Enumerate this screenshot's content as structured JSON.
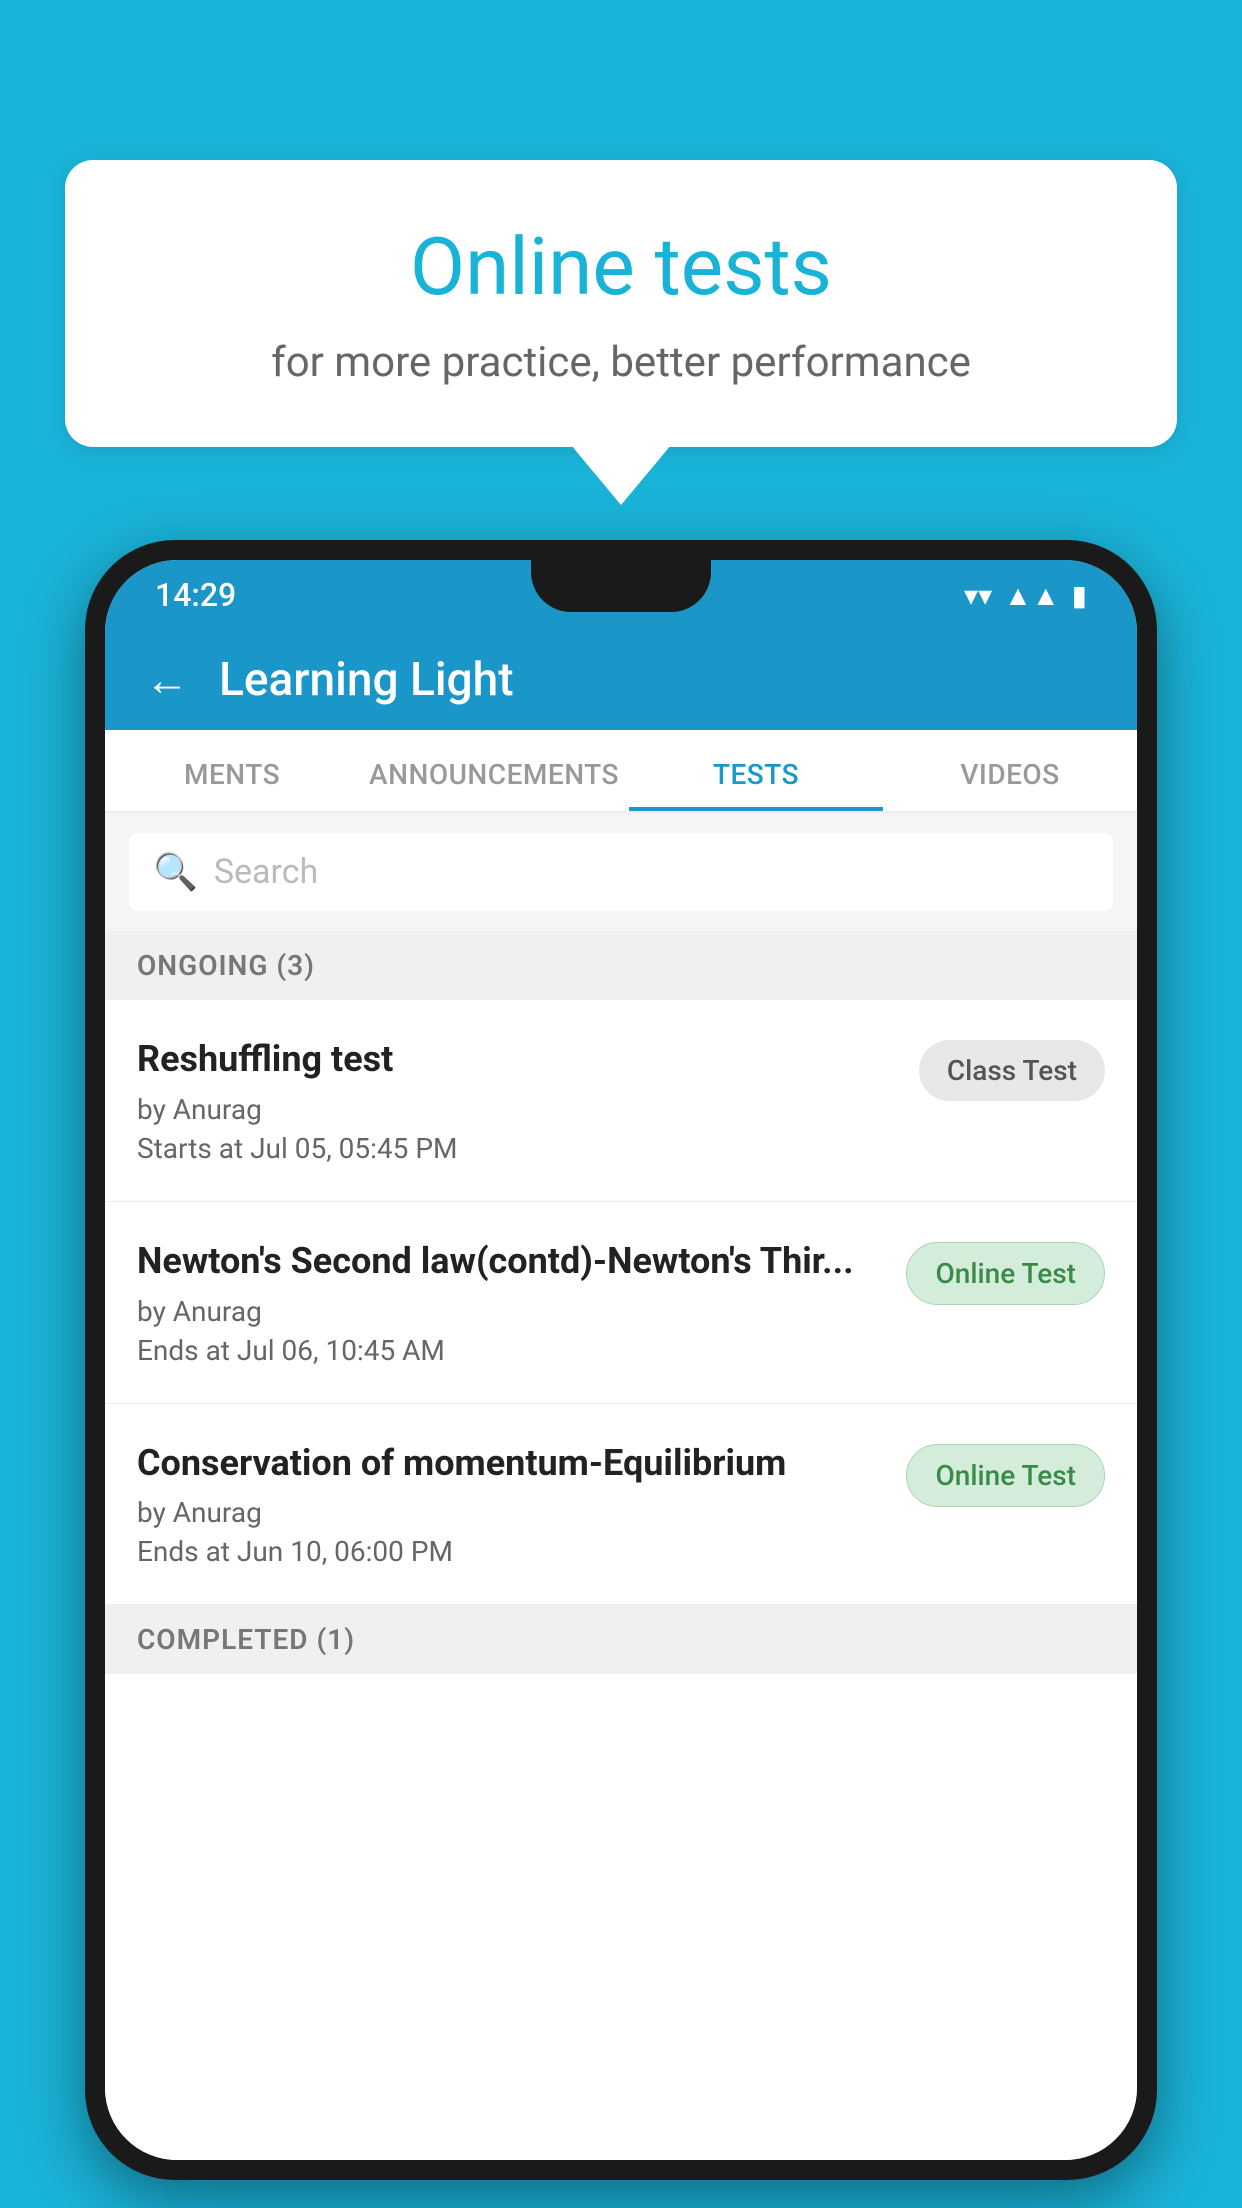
{
  "background_color": "#1ab3d8",
  "speech_bubble": {
    "title": "Online tests",
    "subtitle": "for more practice, better performance"
  },
  "phone": {
    "status_bar": {
      "time": "14:29",
      "wifi_icon": "wifi",
      "signal_icon": "signal",
      "battery_icon": "battery"
    },
    "app_bar": {
      "back_label": "←",
      "title": "Learning Light"
    },
    "tabs": [
      {
        "label": "MENTS",
        "active": false
      },
      {
        "label": "ANNOUNCEMENTS",
        "active": false
      },
      {
        "label": "TESTS",
        "active": true
      },
      {
        "label": "VIDEOS",
        "active": false
      }
    ],
    "search": {
      "placeholder": "Search"
    },
    "ongoing_section": {
      "label": "ONGOING (3)"
    },
    "test_items": [
      {
        "name": "Reshuffling test",
        "author": "by Anurag",
        "time_label": "Starts at",
        "time_value": "Jul 05, 05:45 PM",
        "badge": "Class Test",
        "badge_type": "class"
      },
      {
        "name": "Newton's Second law(contd)-Newton's Thir...",
        "author": "by Anurag",
        "time_label": "Ends at",
        "time_value": "Jul 06, 10:45 AM",
        "badge": "Online Test",
        "badge_type": "online"
      },
      {
        "name": "Conservation of momentum-Equilibrium",
        "author": "by Anurag",
        "time_label": "Ends at",
        "time_value": "Jun 10, 06:00 PM",
        "badge": "Online Test",
        "badge_type": "online"
      }
    ],
    "completed_section": {
      "label": "COMPLETED (1)"
    }
  }
}
